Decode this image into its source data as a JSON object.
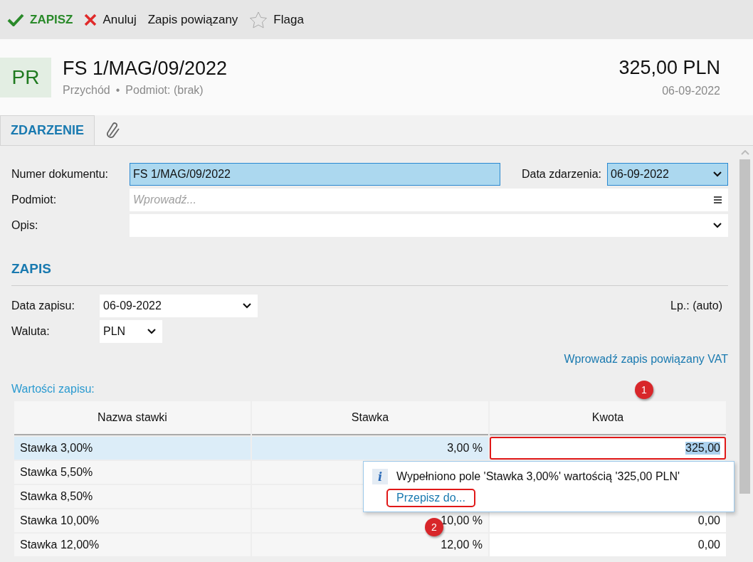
{
  "toolbar": [
    {
      "kind": "save",
      "label": "ZAPISZ"
    },
    {
      "kind": "cancel",
      "label": "Anuluj"
    },
    {
      "kind": "plain",
      "label": "Zapis powiązany"
    },
    {
      "kind": "flag",
      "label": "Flaga"
    }
  ],
  "header": {
    "badge": "PR",
    "title": "FS 1/MAG/09/2022",
    "type": "Przychód",
    "separator": "•",
    "subject": "Podmiot: (brak)",
    "amount": "325,00 PLN",
    "date": "06-09-2022"
  },
  "tabs": [
    {
      "kind": "text",
      "label": "ZDARZENIE",
      "selected": true
    },
    {
      "kind": "attachment",
      "selected": false
    }
  ],
  "event": {
    "doc_label": "Numer dokumentu:",
    "doc_value": "FS 1/MAG/09/2022",
    "date_label": "Data zdarzenia:",
    "date_value": "06-09-2022",
    "subject_label": "Podmiot:",
    "subject_placeholder": "Wprowadź...",
    "desc_label": "Opis:"
  },
  "entry": {
    "title": "ZAPIS",
    "date_label": "Data zapisu:",
    "date_value": "06-09-2022",
    "currency_label": "Waluta:",
    "currency_value": "PLN",
    "lp_label": "Lp.:",
    "lp_value": "(auto)",
    "vat_link": "Wprowadź zapis powiązany VAT",
    "values_label": "Wartości zapisu:"
  },
  "table": {
    "columns": [
      "Nazwa stawki",
      "Stawka",
      "Kwota"
    ],
    "rows": [
      {
        "name": "Stawka 3,00%",
        "rate": "3,00 %",
        "amount": "325,00",
        "selected": true
      },
      {
        "name": "Stawka 5,50%",
        "selected": false
      },
      {
        "name": "Stawka 8,50%",
        "selected": false
      },
      {
        "name": "Stawka 10,00%",
        "rate": "10,00 %",
        "amount": "0,00",
        "selected": false
      },
      {
        "name": "Stawka 12,00%",
        "rate": "12,00 %",
        "amount": "0,00",
        "selected": false
      }
    ]
  },
  "popup": {
    "icon": "i",
    "message": "Wypełniono pole 'Stawka 3,00%' wartością '325,00 PLN'",
    "link": "Przepisz do..."
  },
  "markers": [
    "1",
    "2"
  ]
}
